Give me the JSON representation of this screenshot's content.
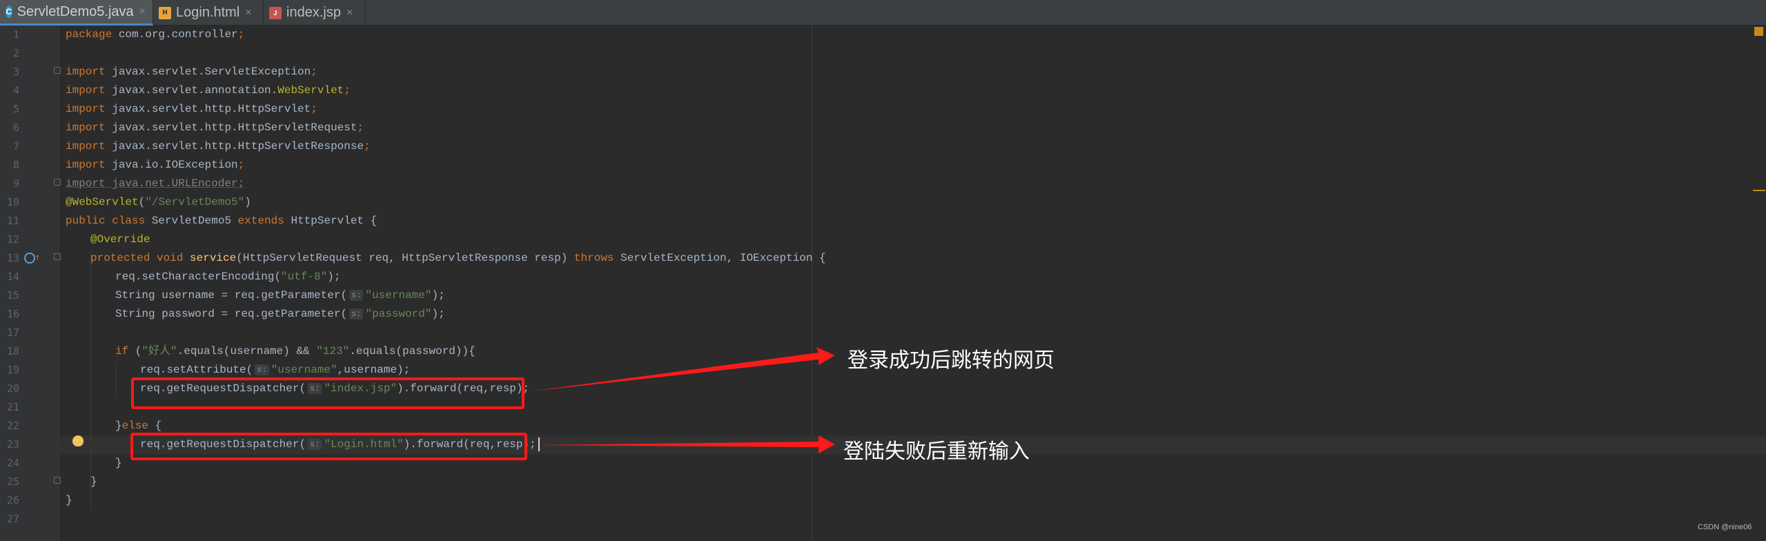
{
  "tabs": [
    {
      "label": "ServletDemo5.java",
      "icon": "java-class-icon",
      "active": true
    },
    {
      "label": "Login.html",
      "icon": "html-file-icon",
      "active": false
    },
    {
      "label": "index.jsp",
      "icon": "jsp-file-icon",
      "active": false
    }
  ],
  "close_glyph": "×",
  "line_numbers": [
    "1",
    "2",
    "3",
    "4",
    "5",
    "6",
    "7",
    "8",
    "9",
    "10",
    "11",
    "12",
    "13",
    "14",
    "15",
    "16",
    "17",
    "18",
    "19",
    "20",
    "21",
    "22",
    "23",
    "24",
    "25",
    "26",
    "27"
  ],
  "code": {
    "l1": {
      "kw": "package",
      "rest": " com.org.controller",
      "semi": ";"
    },
    "l3": {
      "kw": "import",
      "rest": " javax.servlet.ServletException",
      "semi": ";"
    },
    "l4": {
      "kw": "import",
      "rest": " javax.servlet.annotation.",
      "ann": "WebServlet",
      "semi": ";"
    },
    "l5": {
      "kw": "import",
      "rest": " javax.servlet.http.HttpServlet",
      "semi": ";"
    },
    "l6": {
      "kw": "import",
      "rest": " javax.servlet.http.HttpServletRequest",
      "semi": ";"
    },
    "l7": {
      "kw": "import",
      "rest": " javax.servlet.http.HttpServletResponse",
      "semi": ";"
    },
    "l8": {
      "kw": "import",
      "rest": " java.io.IOException",
      "semi": ";"
    },
    "l9": {
      "text": "import java.net.URLEncoder;"
    },
    "l10": {
      "ann": "@WebServlet",
      "p1": "(",
      "str": "\"/ServletDemo5\"",
      "p2": ")"
    },
    "l11": {
      "kw1": "public class",
      "mid": " ServletDemo5 ",
      "kw2": "extends",
      "rest": " HttpServlet {"
    },
    "l12": {
      "ann": "@Override"
    },
    "l13": {
      "kw1": "protected void",
      "fn": " service",
      "p1": "(HttpServletRequest req, HttpServletResponse resp) ",
      "kw2": "throws",
      "rest": " ServletException, IOException {"
    },
    "l14": {
      "pre": "req.setCharacterEncoding(",
      "str": "\"utf-8\"",
      "post": ");"
    },
    "l15": {
      "pre": "String username = req.getParameter(",
      "hint": "s:",
      "str": "\"username\"",
      "post": ");"
    },
    "l16": {
      "pre": "String password = req.getParameter(",
      "hint": "s:",
      "str": "\"password\"",
      "post": ");"
    },
    "l18": {
      "kw": "if",
      "p1": " (",
      "str1": "\"好人\"",
      "p2": ".equals(username) && ",
      "str2": "\"123\"",
      "p3": ".equals(password)){"
    },
    "l19": {
      "pre": "req.setAttribute(",
      "hint": "s:",
      "str": "\"username\"",
      "post": ",username);"
    },
    "l20": {
      "pre": "req.getRequestDispatcher(",
      "hint": "s:",
      "str": "\"index.jsp\"",
      "post": ").forward(req,resp);"
    },
    "l22": {
      "p1": "}",
      "kw": "else",
      "p2": " {"
    },
    "l23": {
      "pre": "req.getRequestDispatcher(",
      "hint": "s:",
      "str": "\"Login.html\"",
      "post": ").forward(req,resp);"
    },
    "l24": {
      "text": "}"
    },
    "l25": {
      "text": "}"
    },
    "l26": {
      "text": "}"
    }
  },
  "annotations": {
    "success": "登录成功后跳转的网页",
    "failure": "登陆失败后重新输入"
  },
  "colors": {
    "background": "#2b2b2b",
    "keyword": "#cc7832",
    "string": "#6a8759",
    "annotation": "#bbb529",
    "highlight_box": "#ff1a1a"
  },
  "watermark": "CSDN @nine06"
}
